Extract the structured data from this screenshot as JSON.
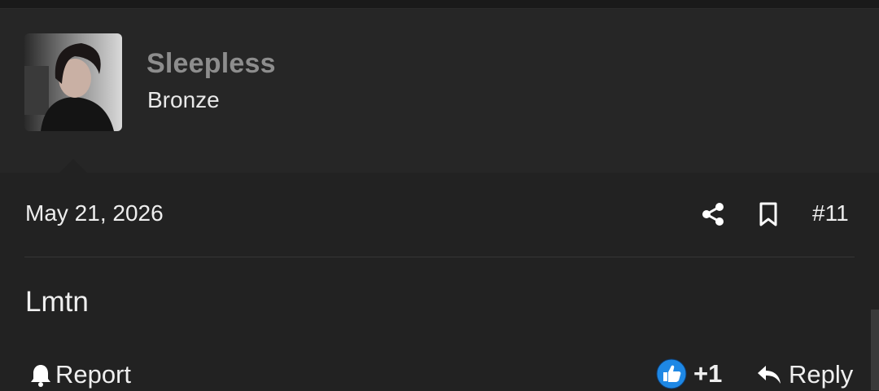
{
  "user": {
    "name": "Sleepless",
    "rank": "Bronze",
    "avatar_alt": "user avatar photo"
  },
  "post": {
    "date": "May 21, 2026",
    "number": "#11",
    "content": "Lmtn"
  },
  "actions": {
    "report_label": "Report",
    "reaction_count": "+1",
    "reply_label": "Reply",
    "share_icon": "share-icon",
    "bookmark_icon": "bookmark-icon",
    "reaction_icon": "thumbs-up-icon"
  },
  "colors": {
    "background": "#222222",
    "header_bg": "#262626",
    "username": "#8d8d8d",
    "reaction_blue": "#1e88e5"
  }
}
